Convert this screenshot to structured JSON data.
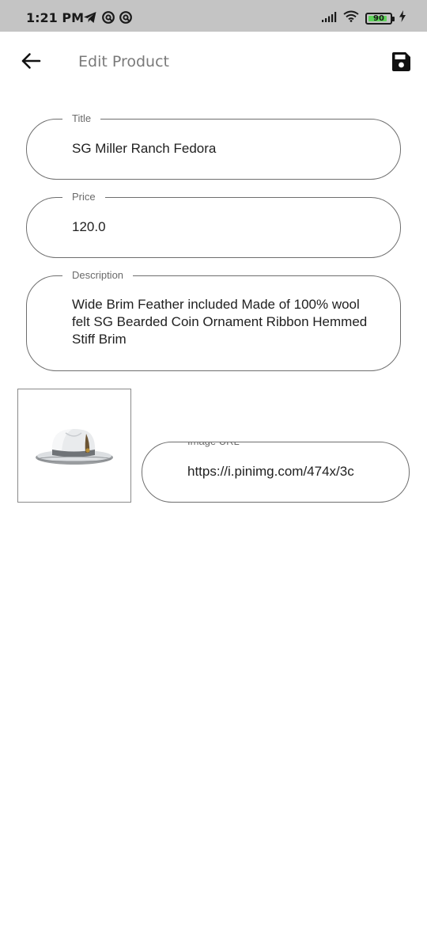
{
  "status_bar": {
    "time": "1:21 PM",
    "left_icons": [
      "telegram-icon",
      "notification-icon",
      "notification-icon"
    ],
    "right_icons": [
      "cellular-signal-icon",
      "wifi-icon",
      "battery-icon",
      "charging-icon"
    ],
    "battery_level": "90",
    "battery_color": "#5fd35a"
  },
  "app_bar": {
    "title": "Edit Product",
    "back_icon": "arrow-left-icon",
    "save_icon": "save-icon"
  },
  "form": {
    "title": {
      "label": "Title",
      "value": "SG Miller Ranch Fedora"
    },
    "price": {
      "label": "Price",
      "value": "120.0"
    },
    "description": {
      "label": "Description",
      "value": "Wide Brim Feather  included Made of 100% wool felt SG Bearded Coin Ornament Ribbon Hemmed Stiff Brim"
    },
    "image_url": {
      "label": "Image URL",
      "value": "https://i.pinimg.com/474x/3c"
    }
  },
  "image_preview": {
    "subject": "fedora-hat"
  }
}
